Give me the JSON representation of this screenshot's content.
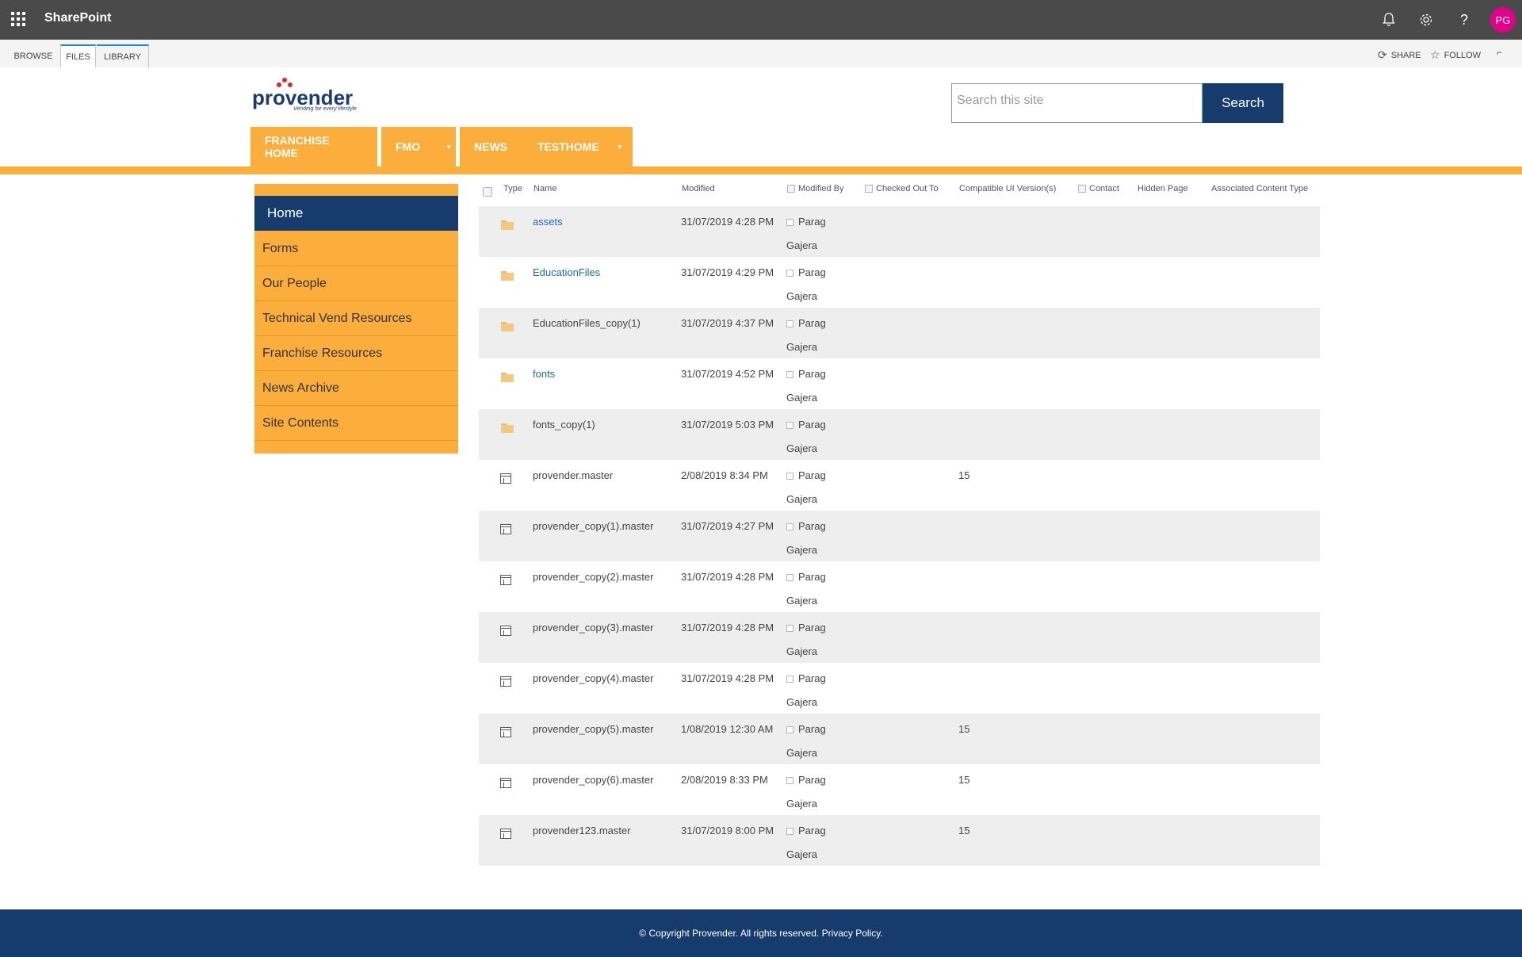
{
  "suitebar": {
    "brand": "SharePoint",
    "avatar_initials": "PG",
    "icons": [
      "bell-icon",
      "gear-icon",
      "help-icon"
    ]
  },
  "ribbon": {
    "tabs": [
      "BROWSE",
      "FILES",
      "LIBRARY"
    ],
    "share_label": "SHARE",
    "follow_label": "FOLLOW"
  },
  "logo": {
    "word": "provender",
    "tagline": "Vending for every lifestyle"
  },
  "search": {
    "placeholder": "Search this site",
    "button_label": "Search"
  },
  "topnav": [
    "FRANCHISE HOME",
    "FMO",
    "NEWS",
    "TESTHOME"
  ],
  "leftnav": [
    "Home",
    "Forms",
    "Our People",
    "Technical Vend Resources",
    "Franchise Resources",
    "News Archive",
    "Site Contents"
  ],
  "table": {
    "headers": {
      "type": "Type",
      "name": "Name",
      "modified": "Modified",
      "modified_by": "Modified By",
      "checked_out_to": "Checked Out To",
      "compatible_ui": "Compatible UI Version(s)",
      "contact": "Contact",
      "hidden_page": "Hidden Page",
      "associated_content_type": "Associated Content Type"
    },
    "rows": [
      {
        "type": "folder",
        "name": "assets",
        "modified": "31/07/2019 4:28 PM",
        "by_first": "Parag",
        "by_last": "Gajera",
        "ui": ""
      },
      {
        "type": "folder",
        "name": "EducationFiles",
        "modified": "31/07/2019 4:29 PM",
        "by_first": "Parag",
        "by_last": "Gajera",
        "ui": ""
      },
      {
        "type": "folder",
        "name": "EducationFiles_copy(1)",
        "modified": "31/07/2019 4:37 PM",
        "by_first": "Parag",
        "by_last": "Gajera",
        "ui": ""
      },
      {
        "type": "folder",
        "name": "fonts",
        "modified": "31/07/2019 4:52 PM",
        "by_first": "Parag",
        "by_last": "Gajera",
        "ui": ""
      },
      {
        "type": "folder",
        "name": "fonts_copy(1)",
        "modified": "31/07/2019 5:03 PM",
        "by_first": "Parag",
        "by_last": "Gajera",
        "ui": ""
      },
      {
        "type": "file",
        "name": "provender.master",
        "modified": "2/08/2019 8:34 PM",
        "by_first": "Parag",
        "by_last": "Gajera",
        "ui": "15"
      },
      {
        "type": "file",
        "name": "provender_copy(1).master",
        "modified": "31/07/2019 4:27 PM",
        "by_first": "Parag",
        "by_last": "Gajera",
        "ui": ""
      },
      {
        "type": "file",
        "name": "provender_copy(2).master",
        "modified": "31/07/2019 4:28 PM",
        "by_first": "Parag",
        "by_last": "Gajera",
        "ui": ""
      },
      {
        "type": "file",
        "name": "provender_copy(3).master",
        "modified": "31/07/2019 4:28 PM",
        "by_first": "Parag",
        "by_last": "Gajera",
        "ui": ""
      },
      {
        "type": "file",
        "name": "provender_copy(4).master",
        "modified": "31/07/2019 4:28 PM",
        "by_first": "Parag",
        "by_last": "Gajera",
        "ui": ""
      },
      {
        "type": "file",
        "name": "provender_copy(5).master",
        "modified": "1/08/2019 12:30 AM",
        "by_first": "Parag",
        "by_last": "Gajera",
        "ui": "15"
      },
      {
        "type": "file",
        "name": "provender_copy(6).master",
        "modified": "2/08/2019 8:33 PM",
        "by_first": "Parag",
        "by_last": "Gajera",
        "ui": "15"
      },
      {
        "type": "file",
        "name": "provender123.master",
        "modified": "31/07/2019 8:00 PM",
        "by_first": "Parag",
        "by_last": "Gajera",
        "ui": "15"
      }
    ]
  },
  "footer": {
    "text": "© Copyright Provender. All rights reserved. Privacy Policy."
  },
  "colors": {
    "suitebar": "#4a4a4a",
    "accent_orange": "#fbae3c",
    "navy": "#163c6e",
    "avatar": "#e3008c",
    "link": "#1e6bb8"
  }
}
